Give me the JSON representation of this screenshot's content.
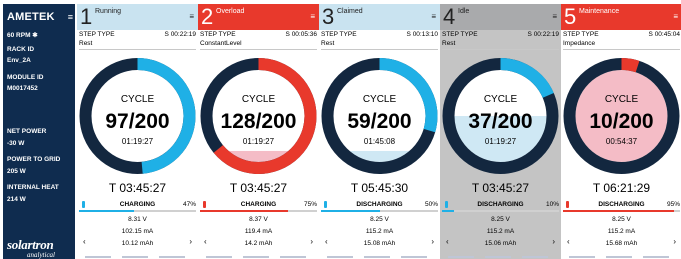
{
  "sidebar": {
    "brand": "AMETEK",
    "menu_icon": "≡",
    "lines": [
      "60 RPM ✱",
      "RACK ID",
      "Env_2A",
      "MODULE ID",
      "M0017452",
      "NET POWER",
      "-30 W",
      "POWER TO GRID",
      "205 W",
      "INTERNAL HEAT",
      "214 W"
    ],
    "logo": "solartron",
    "logo_sub": "analytical"
  },
  "labels": {
    "step_type": "STEP TYPE",
    "cycle": "CYCLE"
  },
  "colors": {
    "navy": "#0f2c4f",
    "blue": "#1fb0e6",
    "red": "#e8392c",
    "pink": "#f4bcc6",
    "light_blue": "#cfe8f4",
    "gray": "#c4c4c4",
    "ring_dark": "#13273f"
  },
  "channels": [
    {
      "number": "1",
      "status": "Running",
      "head_bg": "#c9e3f0",
      "head_fg": "#222222",
      "body_bg": "#ffffff",
      "step_time": "S 00:22:19",
      "step_name": "Rest",
      "cycle_value": "97/200",
      "cycle_time": "01:19:27",
      "ring_progress": 0.485,
      "ring_color": "#1fb0e6",
      "inner_fill": "#ffffff",
      "inner_fill_fraction": 0,
      "total_time": "T 03:45:27",
      "mode": "CHARGING",
      "mode_pct": "47%",
      "mode_fraction": 0.47,
      "mode_color": "#1fb0e6",
      "voltage": "8.31 V",
      "current": "102.15 mA",
      "capacity": "10.12 mAh"
    },
    {
      "number": "2",
      "status": "Overload",
      "head_bg": "#e8392c",
      "head_fg": "#ffffff",
      "body_bg": "#ffffff",
      "step_time": "S 00:05:36",
      "step_name": "ConstantLevel",
      "cycle_value": "128/200",
      "cycle_time": "01:19:27",
      "ring_progress": 0.64,
      "ring_color": "#e8392c",
      "inner_fill": "#f4bcc6",
      "inner_fill_fraction": 0.12,
      "total_time": "T 03:45:27",
      "mode": "CHARGING",
      "mode_pct": "75%",
      "mode_fraction": 0.75,
      "mode_color": "#e8392c",
      "voltage": "8.37 V",
      "current": "119.4 mA",
      "capacity": "14.2 mAh"
    },
    {
      "number": "3",
      "status": "Claimed",
      "head_bg": "#c9e3f0",
      "head_fg": "#222222",
      "body_bg": "#ffffff",
      "step_time": "S 00:13:10",
      "step_name": "Rest",
      "cycle_value": "59/200",
      "cycle_time": "01:45:08",
      "ring_progress": 0.295,
      "ring_color": "#1fb0e6",
      "inner_fill": "#cfe8f4",
      "inner_fill_fraction": 0.12,
      "total_time": "T 05:45:30",
      "mode": "DISCHARGING",
      "mode_pct": "50%",
      "mode_fraction": 0.5,
      "mode_color": "#1fb0e6",
      "voltage": "8.25 V",
      "current": "115.2 mA",
      "capacity": "15.08 mAh"
    },
    {
      "number": "4",
      "status": "Idle",
      "head_bg": "#a9aaac",
      "head_fg": "#222222",
      "body_bg": "#c4c4c4",
      "step_time": "S 00:22:19",
      "step_name": "Rest",
      "cycle_value": "37/200",
      "cycle_time": "01:19:27",
      "ring_progress": 0.185,
      "ring_color": "#1fb0e6",
      "inner_fill": "#cfe8f4",
      "inner_fill_fraction": 0.5,
      "total_time": "T 03:45:27",
      "mode": "DISCHARGING",
      "mode_pct": "10%",
      "mode_fraction": 0.1,
      "mode_color": "#1fb0e6",
      "voltage": "8.25 V",
      "current": "115.2 mA",
      "capacity": "15.06 mAh"
    },
    {
      "number": "5",
      "status": "Maintenance",
      "head_bg": "#e8392c",
      "head_fg": "#ffffff",
      "body_bg": "#ffffff",
      "step_time": "S 00:45:04",
      "step_name": "Impedance",
      "cycle_value": "10/200",
      "cycle_time": "00:54:37",
      "ring_progress": 0.05,
      "ring_color": "#e8392c",
      "inner_fill": "#f4bcc6",
      "inner_fill_fraction": 1,
      "total_time": "T 06:21:29",
      "mode": "DISCHARGING",
      "mode_pct": "95%",
      "mode_fraction": 0.95,
      "mode_color": "#e8392c",
      "voltage": "8.25 V",
      "current": "115.2 mA",
      "capacity": "15.68 mAh"
    }
  ]
}
